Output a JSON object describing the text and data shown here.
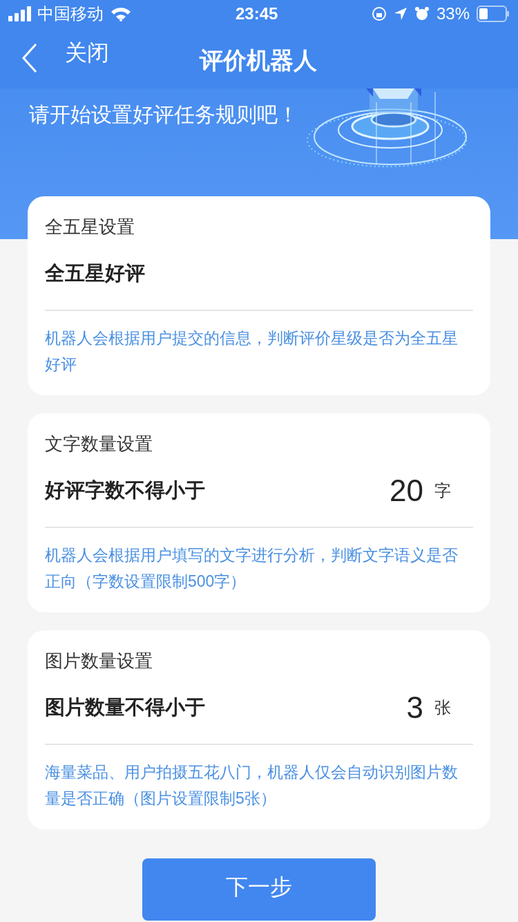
{
  "status_bar": {
    "carrier": "中国移动",
    "time": "23:45",
    "battery": "33%"
  },
  "nav": {
    "back_label": "关闭",
    "title": "评价机器人"
  },
  "banner": {
    "text": "请开始设置好评任务规则吧！"
  },
  "sections": [
    {
      "title": "全五星设置",
      "label": "全五星好评",
      "note": "机器人会根据用户提交的信息，判断评价星级是否为全五星好评"
    },
    {
      "title": "文字数量设置",
      "label": "好评字数不得小于",
      "value": "20",
      "unit": "字",
      "note": "机器人会根据用户填写的文字进行分析，判断文字语义是否正向（字数设置限制500字）"
    },
    {
      "title": "图片数量设置",
      "label": "图片数量不得小于",
      "value": "3",
      "unit": "张",
      "note": "海量菜品、用户拍摄五花八门，机器人仅会自动识别图片数量是否正确（图片设置限制5张）"
    }
  ],
  "next_button": "下一步"
}
